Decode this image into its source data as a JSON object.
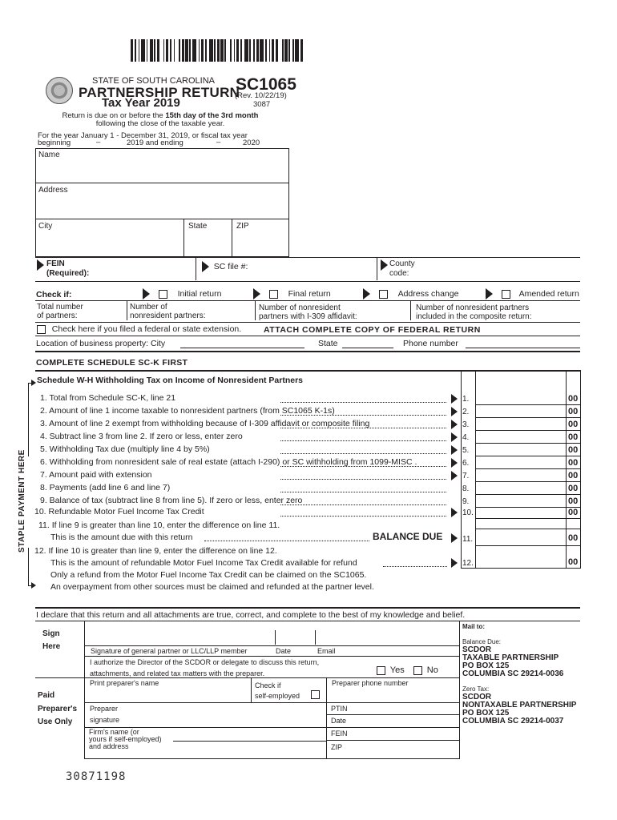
{
  "header": {
    "state": "STATE OF SOUTH CAROLINA",
    "title": "PARTNERSHIP RETURN",
    "tax_year": "Tax Year 2019",
    "form_id": "SC1065",
    "revision": "(Rev. 10/22/19)",
    "form_code": "3087",
    "due_note_prefix": "Return is due on or before the ",
    "due_note_bold": "15th day of the 3rd month",
    "due_note_line2": "following the close of the taxable year.",
    "year_line1": "For the year January 1 - December 31, 2019, or fiscal tax year",
    "year_beginning": "beginning",
    "year_dash1": "–",
    "year_2019_and_ending": "2019 and ending",
    "year_dash2": "–",
    "year_2020": "2020"
  },
  "taxpayer": {
    "name_label": "Name",
    "address_label": "Address",
    "city_label": "City",
    "state_label": "State",
    "zip_label": "ZIP",
    "fein_label": "FEIN",
    "fein_required": "(Required):",
    "sc_file_label": "SC file #:",
    "county_label": "County",
    "county_code": "code:"
  },
  "check_if": {
    "label": "Check if:",
    "options": [
      {
        "label": "Initial return",
        "checked": false
      },
      {
        "label": "Final return",
        "checked": false
      },
      {
        "label": "Address change",
        "checked": false
      },
      {
        "label": "Amended return",
        "checked": false
      }
    ]
  },
  "partners": {
    "total_l1": "Total number",
    "total_l2": "of partners:",
    "nonres_l1": "Number of",
    "nonres_l2": "nonresident partners:",
    "i309_l1": "Number of nonresident",
    "i309_l2": "partners with I-309 affidavit:",
    "composite_l1": "Number of nonresident partners",
    "composite_l2": "included in the composite return:"
  },
  "extension": {
    "label": "Check here if you filed a federal or state extension.",
    "checked": false,
    "attach_note": "ATTACH COMPLETE COPY OF FEDERAL RETURN"
  },
  "location": {
    "label": "Location of business property:  City",
    "state_label": "State",
    "phone_label": "Phone number"
  },
  "schedule": {
    "complete_first": "COMPLETE SCHEDULE SC-K FIRST",
    "title": "Schedule W-H Withholding Tax on Income of Nonresident Partners",
    "staple_label": "STAPLE PAYMENT HERE",
    "lines": [
      {
        "text": "1. Total from Schedule SC-K, line 21",
        "num": "1.",
        "cents": "00",
        "arrow": true
      },
      {
        "text": "2. Amount of line 1 income taxable to nonresident partners (from SC1065 K-1s)",
        "num": "2.",
        "cents": "00",
        "arrow": true
      },
      {
        "text": "3. Amount of line 2 exempt from withholding because of I-309 affidavit or composite filing",
        "num": "3.",
        "cents": "00",
        "arrow": true
      },
      {
        "text": "4. Subtract line 3 from line 2. If zero or less, enter zero",
        "num": "4.",
        "cents": "00",
        "arrow": true
      },
      {
        "text": "5. Withholding Tax due (multiply line 4 by 5%)",
        "num": "5.",
        "cents": "00",
        "arrow": true
      },
      {
        "text": "6. Withholding from nonresident sale of real estate (attach I-290) or SC withholding from 1099-MISC .",
        "num": "6.",
        "cents": "00",
        "arrow": true
      },
      {
        "text": "7. Amount paid with extension",
        "num": "7.",
        "cents": "00",
        "arrow": true
      },
      {
        "text": "8. Payments (add line 6 and line 7)",
        "num": "8.",
        "cents": "00",
        "arrow": false
      },
      {
        "text": "9. Balance of tax (subtract line 8 from line 5). If zero or less, enter zero",
        "num": "9.",
        "cents": "00",
        "arrow": false
      },
      {
        "text": "10. Refundable Motor Fuel Income Tax Credit",
        "num": "10.",
        "cents": "00",
        "arrow": true
      }
    ],
    "line11_l1": "11. If line 9 is greater than line 10, enter the difference on line 11.",
    "line11_l2": "This is the amount due with this return",
    "balance_due": "BALANCE DUE",
    "line11_num": "11.",
    "line11_cents": "00",
    "line12_l1": "12. If line 10 is greater than line 9, enter the difference on line 12.",
    "line12_l2": "This is the amount of refundable Motor Fuel Income Tax Credit available for refund",
    "line12_l3": "Only a refund from the Motor Fuel Income Tax Credit can be claimed on the SC1065.",
    "line12_l4": "An overpayment from other sources must be claimed and refunded at the partner level.",
    "line12_num": "12.",
    "line12_cents": "00"
  },
  "declaration": {
    "text": "I declare that this return and all attachments are true, correct, and complete to the best of my knowledge and belief.",
    "sign": "Sign",
    "here": "Here",
    "sig_label": "Signature of general partner or LLC/LLP member",
    "date_label": "Date",
    "email_label": "Email",
    "authorize_l1": "I authorize the Director of the SCDOR or delegate to discuss this return,",
    "authorize_l2": "attachments, and related tax matters with the preparer.",
    "yes": "Yes",
    "no": "No"
  },
  "preparer": {
    "paid": "Paid",
    "preparers": "Preparer's",
    "use_only": "Use Only",
    "print_name": "Print preparer's name",
    "check_if": "Check if",
    "self_employed": "self-employed",
    "phone": "Preparer phone number",
    "sig_l1": "Preparer",
    "sig_l2": "signature",
    "ptin": "PTIN",
    "date": "Date",
    "firm_l1": "Firm's name (or",
    "firm_l2": "yours if self-employed)",
    "firm_l3": "and address",
    "fein": "FEIN",
    "zip": "ZIP"
  },
  "mail_to": {
    "title": "Mail to:",
    "balance_due_label": "Balance Due:",
    "balance_due_addr": [
      "SCDOR",
      "TAXABLE PARTNERSHIP",
      "PO BOX 125",
      "COLUMBIA SC 29214-0036"
    ],
    "zero_tax_label": "Zero Tax:",
    "zero_tax_addr": [
      "SCDOR",
      "NONTAXABLE PARTNERSHIP",
      "PO BOX 125",
      "COLUMBIA SC 29214-0037"
    ]
  },
  "footer_code": "30871198"
}
